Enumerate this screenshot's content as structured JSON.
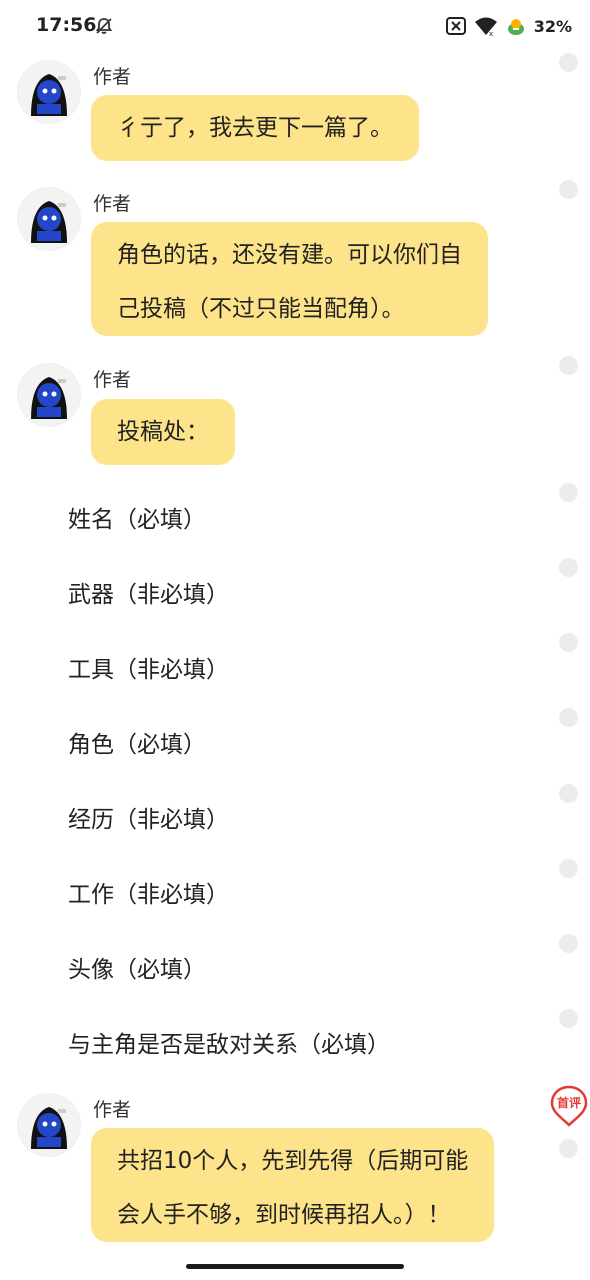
{
  "status_bar": {
    "time": "17:56",
    "battery_text": "32%"
  },
  "messages": [
    {
      "sender": "作者",
      "lines": [
        "彳亍了，我去更下一篇了。"
      ]
    },
    {
      "sender": "作者",
      "lines": [
        "角色的话，还没有建。可以你们自",
        "己投稿（不过只能当配角）。"
      ]
    },
    {
      "sender": "作者",
      "lines": [
        "投稿处："
      ]
    },
    {
      "sender": "作者",
      "lines": [
        "共招10个人，先到先得（后期可能",
        "会人手不够，到时候再招人。）！"
      ]
    }
  ],
  "form_lines": [
    "姓名（必填）",
    "武器（非必填）",
    "工具（非必填）",
    "角色（必填）",
    "经历（非必填）",
    "工作（非必填）",
    "头像（必填）",
    "与主角是否是敌对关系（必填）"
  ],
  "first_review_badge": "首评",
  "colors": {
    "bubble": "#fde48a",
    "dot": "#ececec",
    "badge": "#e53935"
  }
}
